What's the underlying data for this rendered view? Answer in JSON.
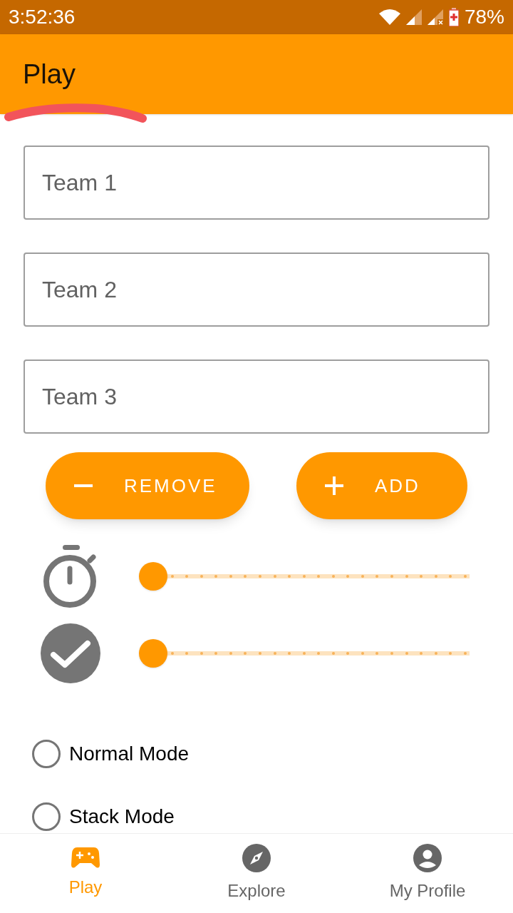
{
  "status_bar": {
    "time": "3:52:36",
    "battery": "78%"
  },
  "app_bar": {
    "title": "Play"
  },
  "team_fields": [
    {
      "placeholder": "Team 1"
    },
    {
      "placeholder": "Team 2"
    },
    {
      "placeholder": "Team 3"
    }
  ],
  "buttons": [
    {
      "kind": "remove",
      "label": "REMOVE"
    },
    {
      "kind": "add",
      "label": "ADD"
    }
  ],
  "sliders": [
    {
      "kind": "timer",
      "level": 0
    },
    {
      "kind": "check",
      "level": 0
    }
  ],
  "modes": [
    {
      "label": "Normal Mode",
      "selected": false
    },
    {
      "label": "Stack Mode",
      "selected": false
    }
  ],
  "nav": [
    {
      "kind": "play",
      "label": "Play",
      "selected": true
    },
    {
      "kind": "explore",
      "label": "Explore",
      "selected": false
    },
    {
      "kind": "profile",
      "label": "My Profile",
      "selected": false
    }
  ]
}
